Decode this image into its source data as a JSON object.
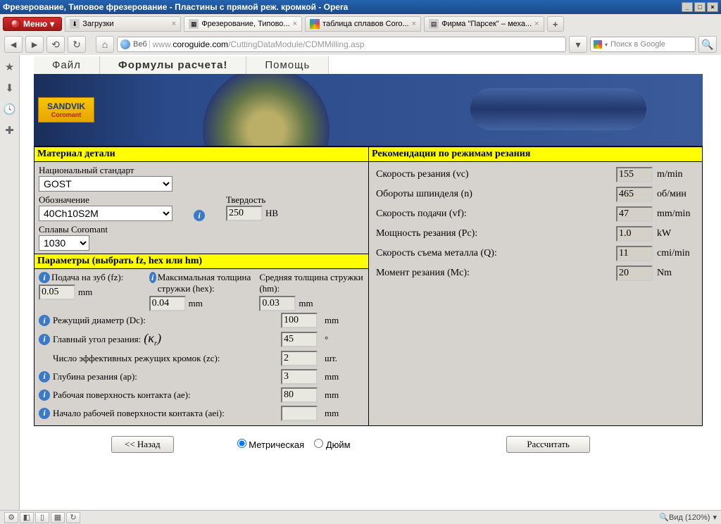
{
  "window": {
    "title": "Фрезерование, Типовое фрезерование - Пластины с прямой реж. кромкой - Opera"
  },
  "opera_menu": "Меню",
  "tabs": [
    {
      "label": "Загрузки"
    },
    {
      "label": "Фрезерование, Типово..."
    },
    {
      "label": "таблица сплавов Coro..."
    },
    {
      "label": "Фирма \"Парсек\" – меха..."
    }
  ],
  "url": {
    "label": "Веб",
    "pre": "www.",
    "host": "coroguide.com",
    "path": "/CuttingDataModule/CDMMilling.asp"
  },
  "search_placeholder": "Поиск в Google",
  "app_menu": {
    "file": "Файл",
    "formulas": "Формулы расчета!",
    "help": "Помощь"
  },
  "brand": {
    "line1": "SANDVIK",
    "line2": "Coromant"
  },
  "section_material": "Материал детали",
  "material": {
    "std_label": "Национальный стандарт",
    "std_value": "GOST",
    "desig_label": "Обозначение",
    "desig_value": "40Ch10S2M",
    "hard_label": "Твердость",
    "hard_value": "250",
    "hard_unit": "HB",
    "alloy_label": "Сплавы Coromant",
    "alloy_value": "1030"
  },
  "section_params": "Параметры (выбрать fz, hex или hm)",
  "params_top": {
    "fz_label": "Подача на зуб (fz):",
    "fz_val": "0.05",
    "fz_unit": "mm",
    "hex_label": "Максимальная толщина стружки (hex):",
    "hex_val": "0.04",
    "hex_unit": "mm",
    "hm_label": "Средняя толщина стружки (hm):",
    "hm_val": "0.03",
    "hm_unit": "mm"
  },
  "params": [
    {
      "label": "Режущий диаметр (Dc):",
      "val": "100",
      "unit": "mm",
      "info": true
    },
    {
      "label": "Главный угол резания:",
      "val": "45",
      "unit": "°",
      "info": true,
      "kappa": true
    },
    {
      "label": "Число эффективных режущих кромок (zc):",
      "val": "2",
      "unit": "шт.",
      "info": false
    },
    {
      "label": "Глубина резания (ap):",
      "val": "3",
      "unit": "mm",
      "info": true
    },
    {
      "label": "Рабочая поверхность контакта (ae):",
      "val": "80",
      "unit": "mm",
      "info": true
    },
    {
      "label": "Начало рабочей поверхности контакта (aei):",
      "val": "",
      "unit": "mm",
      "info": true
    }
  ],
  "section_rec": "Рекомендации по режимам резания",
  "recs": [
    {
      "label": "Скорость резания (vc)",
      "val": "155",
      "unit": "m/min"
    },
    {
      "label": "Обороты шпинделя (n)",
      "val": "465",
      "unit": "об/мин"
    },
    {
      "label": "Скорость подачи (vf):",
      "val": "47",
      "unit": "mm/min"
    },
    {
      "label": "Мощность резания (Pc):",
      "val": "1.0",
      "unit": "kW"
    },
    {
      "label": "Скорость съема металла (Q):",
      "val": "11",
      "unit": "cmі/min"
    },
    {
      "label": "Момент резания (Mc):",
      "val": "20",
      "unit": "Nm"
    }
  ],
  "buttons": {
    "back": "<< Назад",
    "calc": "Рассчитать"
  },
  "units_radio": {
    "metric": "Метрическая",
    "inch": "Дюйм"
  },
  "status": {
    "zoom": "Вид (120%)"
  }
}
